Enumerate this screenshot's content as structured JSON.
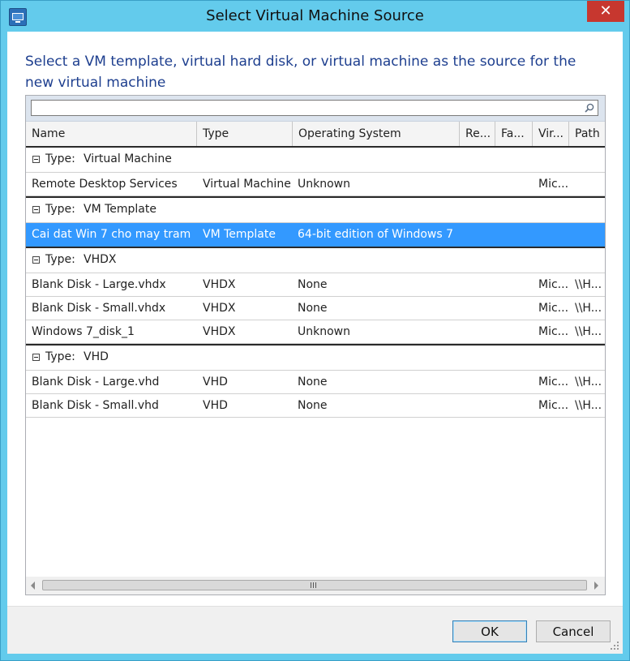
{
  "window": {
    "title": "Select Virtual Machine Source",
    "close_glyph": "✕"
  },
  "instruction": "Select a VM template, virtual hard disk, or virtual machine as the source for the new virtual machine",
  "search": {
    "value": "",
    "placeholder": ""
  },
  "columns": [
    "Name",
    "Type",
    "Operating System",
    "Re...",
    "Fa...",
    "Vir...",
    "Path"
  ],
  "groups": [
    {
      "label": "Type:",
      "value": "Virtual Machine",
      "rows": [
        {
          "name": "Remote Desktop Services",
          "type": "Virtual Machine",
          "os": "Unknown",
          "re": "",
          "fa": "",
          "vir": "Mic...",
          "path": ""
        }
      ]
    },
    {
      "label": "Type:",
      "value": "VM Template",
      "rows": [
        {
          "name": "Cai dat Win 7 cho may tram",
          "type": "VM Template",
          "os": "64-bit edition of Windows 7",
          "re": "",
          "fa": "",
          "vir": "",
          "path": "",
          "selected": true
        }
      ]
    },
    {
      "label": "Type:",
      "value": "VHDX",
      "rows": [
        {
          "name": "Blank Disk - Large.vhdx",
          "type": "VHDX",
          "os": "None",
          "re": "",
          "fa": "",
          "vir": "Mic...",
          "path": "\\\\H..."
        },
        {
          "name": "Blank Disk - Small.vhdx",
          "type": "VHDX",
          "os": "None",
          "re": "",
          "fa": "",
          "vir": "Mic...",
          "path": "\\\\H..."
        },
        {
          "name": "Windows 7_disk_1",
          "type": "VHDX",
          "os": "Unknown",
          "re": "",
          "fa": "",
          "vir": "Mic...",
          "path": "\\\\H..."
        }
      ]
    },
    {
      "label": "Type:",
      "value": "VHD",
      "rows": [
        {
          "name": "Blank Disk - Large.vhd",
          "type": "VHD",
          "os": "None",
          "re": "",
          "fa": "",
          "vir": "Mic...",
          "path": "\\\\H..."
        },
        {
          "name": "Blank Disk - Small.vhd",
          "type": "VHD",
          "os": "None",
          "re": "",
          "fa": "",
          "vir": "Mic...",
          "path": "\\\\H..."
        }
      ]
    }
  ],
  "buttons": {
    "ok": "OK",
    "cancel": "Cancel"
  },
  "colors": {
    "selection": "#3399ff",
    "instruction_text": "#1e3f8f",
    "title_bar": "#63cbec",
    "close": "#c7372f"
  },
  "icons": [
    "app-icon",
    "search-icon",
    "collapse-icon",
    "scroll-left-icon",
    "scroll-right-icon",
    "resize-grip-icon"
  ]
}
